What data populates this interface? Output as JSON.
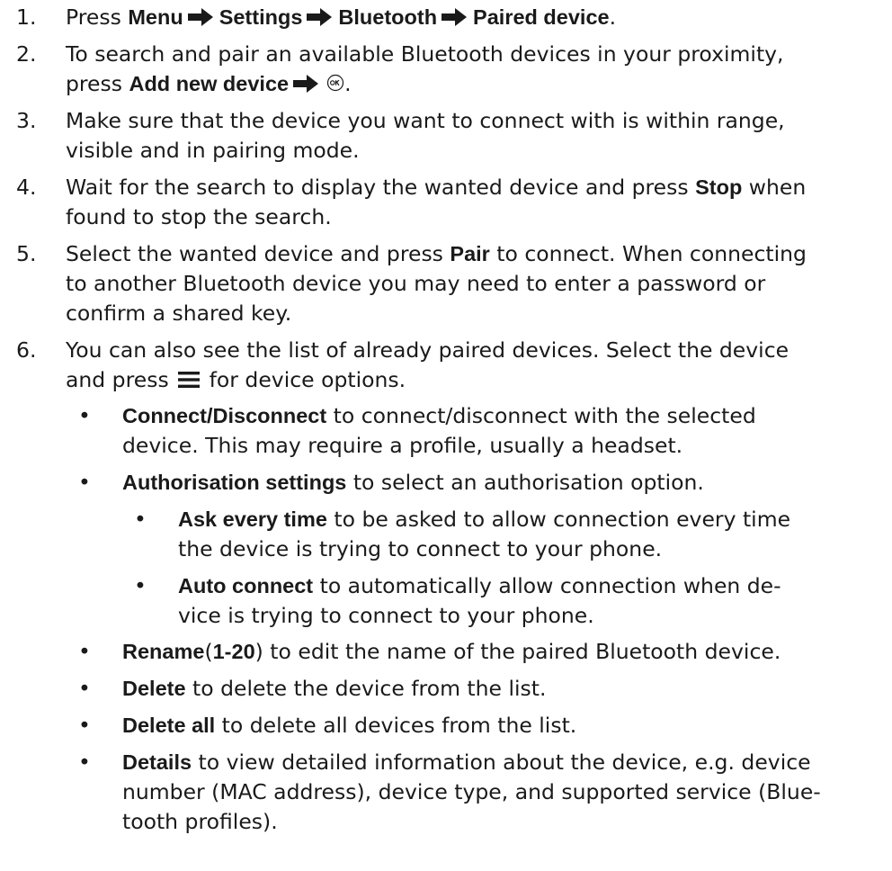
{
  "steps": [
    {
      "number": "1.",
      "before": "Press ",
      "menu": "Menu",
      "settings": "Settings",
      "bluetooth": "Bluetooth",
      "paired": "Paired device",
      "after": "."
    },
    {
      "number": "2.",
      "line1": "To search and pair an available Bluetooth devices in your proximity,",
      "before": "press ",
      "bold": "Add new device",
      "after": "."
    },
    {
      "number": "3.",
      "line1": "Make sure that the device you want to connect with is within range,",
      "line2": "visible and in pairing mode."
    },
    {
      "number": "4.",
      "before": "Wait for the search to display the wanted device and press ",
      "bold": "Stop",
      "after": " when",
      "line2": "found to stop the search."
    },
    {
      "number": "5.",
      "before": "Select the wanted device and press ",
      "bold": "Pair",
      "after": " to connect. When connecting",
      "line2": "to another Bluetooth device you may need to enter a password or",
      "line3": "confirm a shared key."
    },
    {
      "number": "6.",
      "line1": "You can also see the list of already paired devices. Select the device",
      "before": "and press ",
      "after": " for device options."
    }
  ],
  "bullet_symbol": "•",
  "options": {
    "connect": {
      "bold": "Connect/Disconnect",
      "after": " to connect/disconnect with the selected",
      "line2": "device. This may require a profile, usually a headset."
    },
    "authorisation": {
      "bold": "Authorisation settings",
      "after": " to select an authorisation option."
    },
    "ask": {
      "bold": "Ask every time",
      "after": " to be asked to allow connection every time",
      "line2": "the device is trying to connect to your phone."
    },
    "auto": {
      "bold": "Auto connect",
      "after": " to automatically allow connection when de-",
      "line2": "vice is trying to connect to your phone."
    },
    "rename": {
      "bold": "Rename",
      "paren_open": "(",
      "bold2": "1-20",
      "after": ") to edit the name of the paired Bluetooth device."
    },
    "delete": {
      "bold": "Delete",
      "after": " to delete the device from the list."
    },
    "delete_all": {
      "bold": "Delete all",
      "after": " to delete all devices from the list."
    },
    "details": {
      "bold": "Details",
      "after": " to view detailed information about the device, e.g. device",
      "line2": "number (MAC address), device type, and supported service (Blue-",
      "line3": "tooth profiles)."
    }
  },
  "icons": {
    "arrow": "arrow-right-icon",
    "ok": "ok-key-icon",
    "menu": "menu-lines-icon"
  }
}
